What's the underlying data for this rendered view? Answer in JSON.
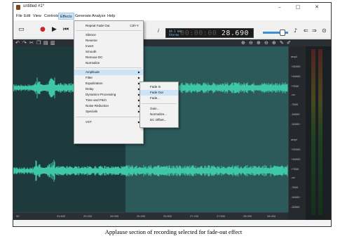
{
  "window": {
    "title": "untitled #1*",
    "minimize": "–",
    "maximize": "□",
    "close": "✕"
  },
  "menubar": {
    "items": [
      {
        "label": "File"
      },
      {
        "label": "Edit"
      },
      {
        "label": "View"
      },
      {
        "label": "Controls"
      },
      {
        "label": "Effects"
      },
      {
        "label": "Generate"
      },
      {
        "label": "Analyze"
      },
      {
        "label": "Help"
      }
    ]
  },
  "toolbar": {
    "sample_rate": "44.1 kHz",
    "channels": "Stereo",
    "time_dim": "00:00:00",
    "time": "28.690",
    "icons": [
      "window-icon",
      "record-icon",
      "play-icon",
      "skip-icon",
      "info-icon",
      "speaker-icon",
      "back-icon",
      "forward-icon",
      "help-icon"
    ]
  },
  "effects_menu": {
    "items": [
      {
        "label": "Repeat Fade Out",
        "shortcut": "Ctrl+Y"
      },
      {
        "label": "Silence"
      },
      {
        "label": "Reverse"
      },
      {
        "label": "Invert"
      },
      {
        "label": "Smooth"
      },
      {
        "label": "Remove DC"
      },
      {
        "label": "Normalize"
      },
      {
        "label": "Amplitude",
        "sub": true
      },
      {
        "label": "Filter",
        "sub": true
      },
      {
        "label": "Equalization",
        "sub": true
      },
      {
        "label": "Delay",
        "sub": true
      },
      {
        "label": "Dynamics Processing",
        "sub": true
      },
      {
        "label": "Time and Pitch",
        "sub": true
      },
      {
        "label": "Noise Reduction",
        "sub": true
      },
      {
        "label": "Specials",
        "sub": true
      },
      {
        "label": "VST",
        "sub": true
      }
    ]
  },
  "amplitude_submenu": {
    "items": [
      {
        "label": "Fade In"
      },
      {
        "label": "Fade Out"
      },
      {
        "label": "Fade..."
      },
      {
        "label": "Gain..."
      },
      {
        "label": "Normalize..."
      },
      {
        "label": "DC Offset..."
      }
    ]
  },
  "db_scale": {
    "ch1": [
      "ampl",
      "+32000",
      "+16000",
      "+7600",
      "-oo",
      "-7600",
      "-16000",
      "-32000"
    ],
    "ch2": [
      "ampl",
      "+32000",
      "+16000",
      "+7600",
      "-oo",
      "-7600",
      "-16000",
      "-32000"
    ]
  },
  "timeline": [
    "90",
    "24.600",
    "25.000",
    "26.000",
    "26.400",
    "26.800",
    "27.200",
    "27.600",
    "28.000",
    "28.400"
  ],
  "colors": {
    "waveform": "#3fc7a6",
    "selection": "#2c5a5b",
    "background": "#1d3a3c"
  },
  "caption": "Applause section of recording selected for fade-out effect"
}
